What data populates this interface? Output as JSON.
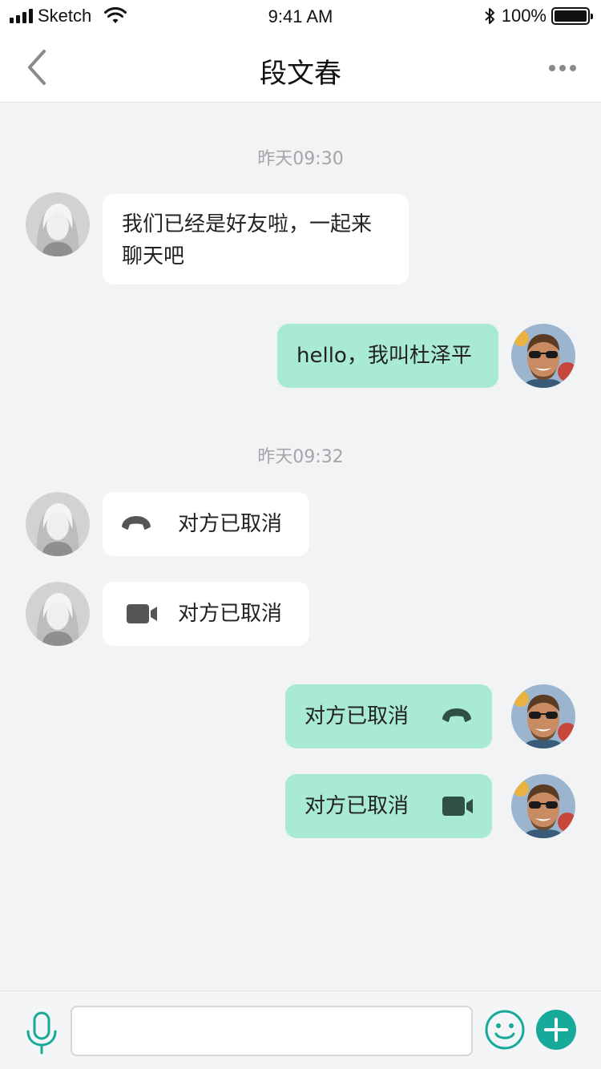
{
  "status_bar": {
    "carrier": "Sketch",
    "time": "9:41 AM",
    "battery": "100%"
  },
  "header": {
    "title": "段文春",
    "back_icon": "chevron-left-icon",
    "more_icon": "more-icon"
  },
  "messages": [
    {
      "type": "timestamp",
      "text": "昨天09:30"
    },
    {
      "type": "text",
      "direction": "in",
      "text_line1": "我们已经是好友啦，一起来",
      "text_line2": "聊天吧"
    },
    {
      "type": "text",
      "direction": "out",
      "text": "hello，我叫杜泽平"
    },
    {
      "type": "timestamp",
      "text": "昨天09:32"
    },
    {
      "type": "call",
      "direction": "in",
      "call_kind": "voice",
      "icon": "phone-hangup-icon",
      "text": "对方已取消"
    },
    {
      "type": "call",
      "direction": "in",
      "call_kind": "video",
      "icon": "video-camera-icon",
      "text": "对方已取消"
    },
    {
      "type": "call",
      "direction": "out",
      "call_kind": "voice",
      "icon": "phone-hangup-icon",
      "text": "对方已取消"
    },
    {
      "type": "call",
      "direction": "out",
      "call_kind": "video",
      "icon": "video-camera-icon",
      "text": "对方已取消"
    }
  ],
  "input_bar": {
    "value": "",
    "placeholder": ""
  },
  "colors": {
    "background": "#F2F3F5",
    "incoming_bubble": "#FFFFFF",
    "outgoing_bubble": "#A8EAD6",
    "accent": "#17A999",
    "timestamp": "#A4A5A8"
  }
}
